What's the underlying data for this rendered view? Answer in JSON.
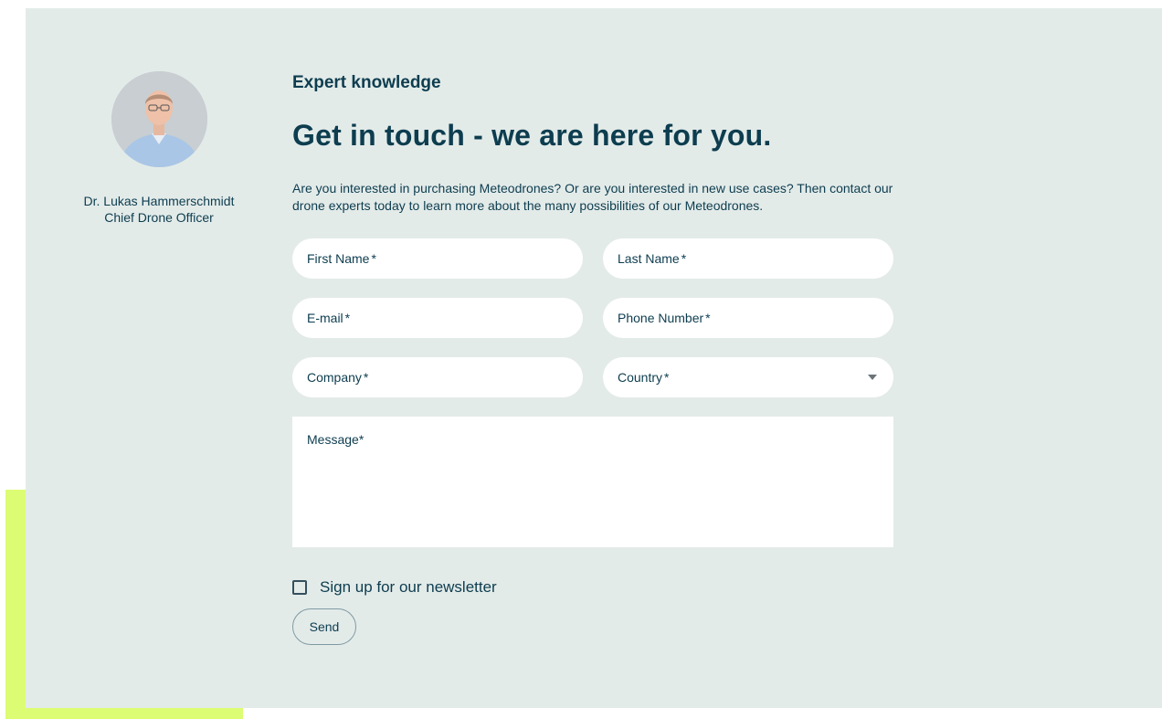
{
  "profile": {
    "name": "Dr. Lukas Hammerschmidt",
    "role": "Chief Drone Officer"
  },
  "section": {
    "eyebrow": "Expert knowledge",
    "headline": "Get in touch - we are here for you.",
    "intro": "Are you interested in purchasing Meteodrones? Or are you interested in new use cases? Then contact our drone experts today to learn more about the many possibilities of our Meteodrones."
  },
  "form": {
    "first_name": "First Name",
    "last_name": "Last Name",
    "email": "E-mail",
    "phone": "Phone Number",
    "company": "Company",
    "country": "Country",
    "message": "Message",
    "required_mark": "*",
    "newsletter_label": "Sign up for our newsletter",
    "send_label": "Send"
  },
  "colors": {
    "panel": "#e3ebe9",
    "accent": "#dcfc73",
    "text": "#0d3d4f"
  }
}
